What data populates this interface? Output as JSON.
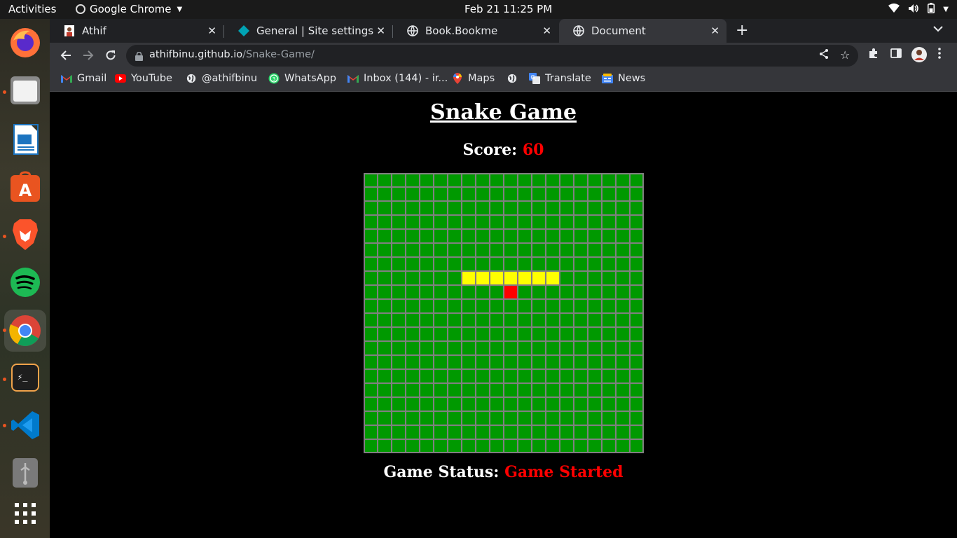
{
  "system": {
    "activities": "Activities",
    "app_name": "Google Chrome",
    "clock": "Feb 21  11:25 PM"
  },
  "tabs": [
    {
      "label": "Athif"
    },
    {
      "label": "General | Site settings"
    },
    {
      "label": "Book.Bookme"
    },
    {
      "label": "Document"
    }
  ],
  "omnibox": {
    "host": "athifbinu.github.io",
    "path": "/Snake-Game/"
  },
  "bookmarks": [
    {
      "label": "Gmail"
    },
    {
      "label": "YouTube"
    },
    {
      "label": "@athifbinu"
    },
    {
      "label": "WhatsApp"
    },
    {
      "label": "Inbox (144) - ir..."
    },
    {
      "label": "Maps"
    },
    {
      "label": ""
    },
    {
      "label": "Translate"
    },
    {
      "label": "News"
    }
  ],
  "game": {
    "title": "Snake Game",
    "score_label": "Score:",
    "score_value": "60",
    "status_label": "Game Status:",
    "status_value": "Game Started",
    "grid_cols": 20,
    "grid_rows": 20,
    "snake": [
      [
        7,
        7
      ],
      [
        8,
        7
      ],
      [
        9,
        7
      ],
      [
        10,
        7
      ],
      [
        11,
        7
      ],
      [
        12,
        7
      ],
      [
        13,
        7
      ]
    ],
    "food": [
      10,
      8
    ],
    "colors": {
      "board": "#009900",
      "grid_line": "#808080",
      "snake": "#ffff00",
      "food": "#ff0000"
    }
  }
}
